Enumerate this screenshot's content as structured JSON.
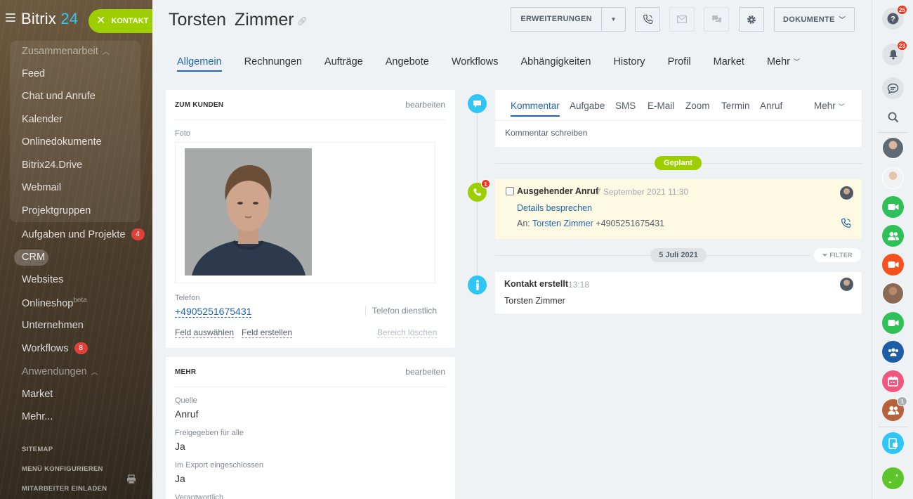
{
  "app": {
    "logo_text": "Bitrix",
    "logo_num": "24"
  },
  "header": {
    "create_button": "KONTAKT",
    "title": "Torsten  Zimmer",
    "extensions_label": "ERWEITERUNGEN",
    "documents_label": "DOKUMENTE"
  },
  "sidebar": {
    "group_title": "Zusammenarbeit",
    "items": [
      {
        "label": "Feed"
      },
      {
        "label": "Chat und Anrufe"
      },
      {
        "label": "Kalender"
      },
      {
        "label": "Onlinedokumente"
      },
      {
        "label": "Bitrix24.Drive"
      },
      {
        "label": "Webmail"
      },
      {
        "label": "Projektgruppen"
      },
      {
        "label": "Aufgaben und Projekte",
        "badge": "4"
      },
      {
        "label": "CRM"
      },
      {
        "label": "Websites"
      },
      {
        "label": "Onlineshop",
        "sup": "beta"
      },
      {
        "label": "Unternehmen"
      },
      {
        "label": "Workflows",
        "badge": "8"
      },
      {
        "label": "Anwendungen"
      },
      {
        "label": "Market"
      },
      {
        "label": "Mehr..."
      }
    ],
    "footer": [
      "SITEMAP",
      "MENÜ KONFIGURIEREN",
      "MITARBEITER EINLADEN"
    ]
  },
  "tabs": [
    {
      "label": "Allgemein",
      "active": true
    },
    {
      "label": "Rechnungen"
    },
    {
      "label": "Aufträge"
    },
    {
      "label": "Angebote"
    },
    {
      "label": "Workflows"
    },
    {
      "label": "Abhängigkeiten"
    },
    {
      "label": "History"
    },
    {
      "label": "Profil"
    },
    {
      "label": "Market"
    },
    {
      "label": "Mehr"
    }
  ],
  "card_kunde": {
    "heading": "ZUM KUNDEN",
    "edit_label": "bearbeiten",
    "photo_label": "Foto",
    "phone_label": "Telefon",
    "phone_value": "+4905251675431",
    "phone_type": "Telefon dienstlich",
    "select_field": "Feld auswählen",
    "create_field": "Feld erstellen",
    "delete_section": "Bereich löschen"
  },
  "card_mehr": {
    "heading": "MEHR",
    "edit_label": "bearbeiten",
    "fields": [
      {
        "label": "Quelle",
        "value": "Anruf"
      },
      {
        "label": "Freigegeben für alle",
        "value": "Ja"
      },
      {
        "label": "Im Export eingeschlossen",
        "value": "Ja"
      },
      {
        "label": "Verantwortlich",
        "value": ""
      }
    ]
  },
  "timeline": {
    "editor_tabs": [
      "Kommentar",
      "Aufgabe",
      "SMS",
      "E-Mail",
      "Zoom",
      "Termin",
      "Anruf",
      "Mehr"
    ],
    "editor_placeholder": "Kommentar schreiben",
    "planned_label": "Geplant",
    "call_badge": "1",
    "activity": {
      "title": "Ausgehender Anruf",
      "date": "7 September 2021 11:30",
      "subject": "Details besprechen",
      "to_label": "An:",
      "to_name": "Torsten Zimmer",
      "to_number": "+4905251675431"
    },
    "date_separator": "5 Juli 2021",
    "filter_label": "FILTER",
    "created": {
      "title": "Kontakt erstellt",
      "time": "13:18",
      "name": "Torsten Zimmer"
    }
  },
  "rightbar": {
    "help_badge": "25",
    "notifications_badge": "23",
    "group_badge": "1"
  },
  "colors": {
    "accent_blue": "#2067b0",
    "brand_green": "#9dcf00",
    "timeline_blue": "#2fc6f6",
    "badge_red": "#f1361b"
  }
}
